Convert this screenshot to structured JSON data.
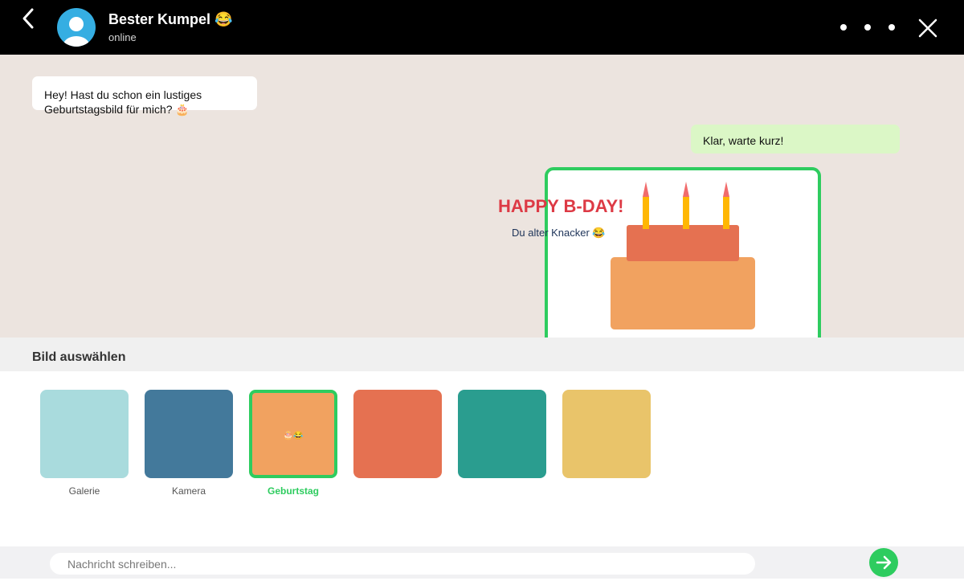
{
  "header": {
    "contact_name": "Bester Kumpel 😂",
    "status": "online"
  },
  "chat": {
    "incoming": {
      "line1": "Hey! Hast du schon ein lustiges",
      "line2": "Geburtstagsbild für mich? 🎂"
    },
    "outgoing": "Klar, warte kurz!",
    "card": {
      "title": "HAPPY B-DAY!",
      "subtitle": "Du alter Knacker 😂"
    }
  },
  "picker": {
    "title": "Bild auswählen",
    "thumbs": [
      {
        "label": "Galerie",
        "color": "#a9dbdd",
        "selected": false
      },
      {
        "label": "Kamera",
        "color": "#43799b",
        "selected": false
      },
      {
        "label": "Geburtstag",
        "color": "#f1a260",
        "selected": true,
        "emoji": "🎂😂"
      },
      {
        "label": "",
        "color": "#e57151",
        "selected": false
      },
      {
        "label": "",
        "color": "#2a9d8f",
        "selected": false
      },
      {
        "label": "",
        "color": "#e9c46a",
        "selected": false
      }
    ]
  },
  "composer": {
    "placeholder": "Nachricht schreiben..."
  },
  "colors": {
    "accent": "#2ecc5f",
    "header": "#000000",
    "chat_background": "#ece4df",
    "outgoing_bubble": "#dbf7c6",
    "card_title": "#dd3a45"
  },
  "icons": {
    "back": "chevron-left-icon",
    "more": "more-dots-icon",
    "close": "close-icon",
    "send": "arrow-right-icon"
  }
}
